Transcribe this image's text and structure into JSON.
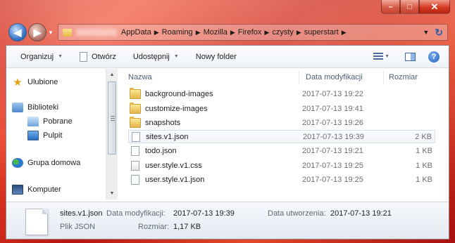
{
  "window": {
    "controls": {
      "minimize": "–",
      "maximize": "□",
      "close": "✕"
    }
  },
  "nav": {
    "back_icon": "arrow-left-icon",
    "forward_icon": "arrow-right-icon"
  },
  "address": {
    "crumbs": [
      "AppData",
      "Roaming",
      "Mozilla",
      "Firefox",
      "czysty",
      "superstart"
    ],
    "separator": "▶"
  },
  "toolbar": {
    "organize": "Organizuj",
    "open": "Otwórz",
    "share": "Udostępnij",
    "new_folder": "Nowy folder"
  },
  "sidebar": {
    "favorites": "Ulubione",
    "libraries": "Biblioteki",
    "downloads": "Pobrane",
    "desktop": "Pulpit",
    "homegroup": "Grupa domowa",
    "computer": "Komputer"
  },
  "columns": {
    "name": "Nazwa",
    "date": "Data modyfikacji",
    "size": "Rozmiar"
  },
  "files": [
    {
      "name": "background-images",
      "date": "2017-07-13 19:22",
      "size": "",
      "type": "folder"
    },
    {
      "name": "customize-images",
      "date": "2017-07-13 19:41",
      "size": "",
      "type": "folder"
    },
    {
      "name": "snapshots",
      "date": "2017-07-13 19:26",
      "size": "",
      "type": "folder"
    },
    {
      "name": "sites.v1.json",
      "date": "2017-07-13 19:39",
      "size": "2 KB",
      "type": "file"
    },
    {
      "name": "todo.json",
      "date": "2017-07-13 19:21",
      "size": "1 KB",
      "type": "file"
    },
    {
      "name": "user.style.v1.css",
      "date": "2017-07-13 19:25",
      "size": "1 KB",
      "type": "css"
    },
    {
      "name": "user.style.v1.json",
      "date": "2017-07-13 19:25",
      "size": "1 KB",
      "type": "file"
    }
  ],
  "details": {
    "filename": "sites.v1.json",
    "filetype": "Plik JSON",
    "modified_label": "Data modyfikacji:",
    "modified_value": "2017-07-13 19:39",
    "created_label": "Data utworzenia:",
    "created_value": "2017-07-13 19:21",
    "size_label": "Rozmiar:",
    "size_value": "1,17 KB"
  }
}
